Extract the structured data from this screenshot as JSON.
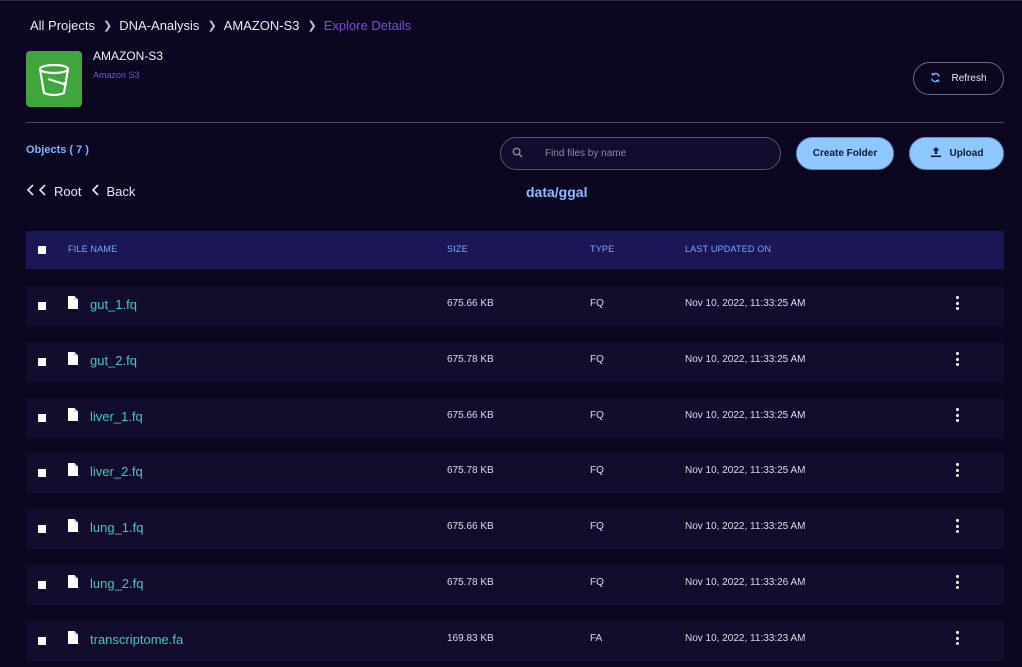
{
  "breadcrumb": {
    "items": [
      "All Projects",
      "DNA-Analysis",
      "AMAZON-S3"
    ],
    "current": "Explore Details"
  },
  "header": {
    "name": "AMAZON-S3",
    "subtitle": "Amazon S3",
    "refresh_label": "Refresh",
    "logo_icon": "s3-bucket-icon",
    "logo_color": "#3ea63a"
  },
  "toolbar": {
    "objects_label": "Objects ( 7 )",
    "search_placeholder": "Find files by name",
    "search_value": "",
    "create_folder_label": "Create Folder",
    "upload_label": "Upload",
    "root_label": "Root",
    "back_label": "Back",
    "path": "data/ggal"
  },
  "table": {
    "columns": [
      "FILE NAME",
      "SIZE",
      "TYPE",
      "LAST UPDATED ON"
    ],
    "rows": [
      {
        "name": "gut_1.fq",
        "size": "675.66 KB",
        "type": "FQ",
        "updated": "Nov 10, 2022, 11:33:25 AM"
      },
      {
        "name": "gut_2.fq",
        "size": "675.78 KB",
        "type": "FQ",
        "updated": "Nov 10, 2022, 11:33:25 AM"
      },
      {
        "name": "liver_1.fq",
        "size": "675.66 KB",
        "type": "FQ",
        "updated": "Nov 10, 2022, 11:33:25 AM"
      },
      {
        "name": "liver_2.fq",
        "size": "675.78 KB",
        "type": "FQ",
        "updated": "Nov 10, 2022, 11:33:25 AM"
      },
      {
        "name": "lung_1.fq",
        "size": "675.66 KB",
        "type": "FQ",
        "updated": "Nov 10, 2022, 11:33:25 AM"
      },
      {
        "name": "lung_2.fq",
        "size": "675.78 KB",
        "type": "FQ",
        "updated": "Nov 10, 2022, 11:33:26 AM"
      },
      {
        "name": "transcriptome.fa",
        "size": "169.83 KB",
        "type": "FA",
        "updated": "Nov 10, 2022, 11:33:23 AM"
      }
    ]
  },
  "colors": {
    "background": "#0b0720",
    "accent_purple": "#7c4dd8",
    "primary_button": "#8ec8ff",
    "file_link": "#3ec8c8",
    "header_text": "#7fa8ff"
  }
}
